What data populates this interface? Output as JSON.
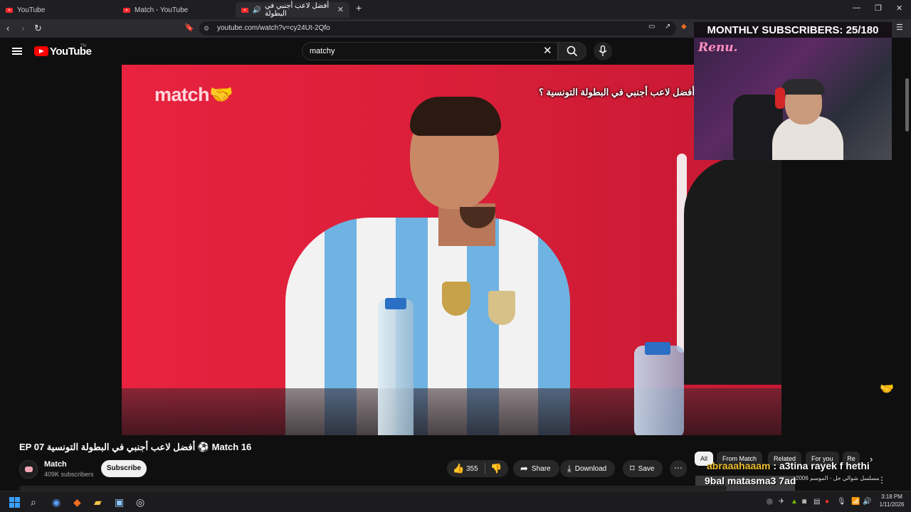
{
  "browser": {
    "tabs": [
      {
        "label": "YouTube"
      },
      {
        "label": "Match - YouTube"
      },
      {
        "label": "أفضل لاعب أجنبي في البطولة"
      }
    ],
    "url": "youtube.com/watch?v=cy24Ut-2Qfo"
  },
  "youtube": {
    "logo_text": "YouTube",
    "logo_sup": "TN",
    "search_value": "matchy"
  },
  "video": {
    "brand": "match",
    "subtitle": "أفضل لاعب أجنبي في البطولة التونسية ؟"
  },
  "overlay": {
    "title": "MONTHLY SUBSCRIBERS: 25/180",
    "cam_logo": "Renu."
  },
  "info": {
    "title": "EP 07 أفضل لاعب أجنبي في البطولة التونسية ⚽ Match 16",
    "channel": "Match",
    "subscribers": "409K subscribers",
    "subscribe_label": "Subscribe",
    "likes": "355",
    "share_label": "Share",
    "download_label": "Download",
    "save_label": "Save"
  },
  "chips": [
    {
      "label": "All"
    },
    {
      "label": "From Match"
    },
    {
      "label": "Related"
    },
    {
      "label": "For you"
    },
    {
      "label": "Re"
    }
  ],
  "chat": {
    "line1_user": "abraaahaaam",
    "line1_text": " : a3tina rayek f hethi",
    "line2": "9bal matasma3 7ad",
    "side_title": "مسلسل شوالي حل - الموسم 2006"
  },
  "taskbar": {
    "time": "3:18 PM",
    "date": "1/11/2026"
  },
  "colors": {
    "youtube_red": "#ff0000",
    "video_wall": "#e01f3d",
    "chat_username": "#f0c030"
  }
}
